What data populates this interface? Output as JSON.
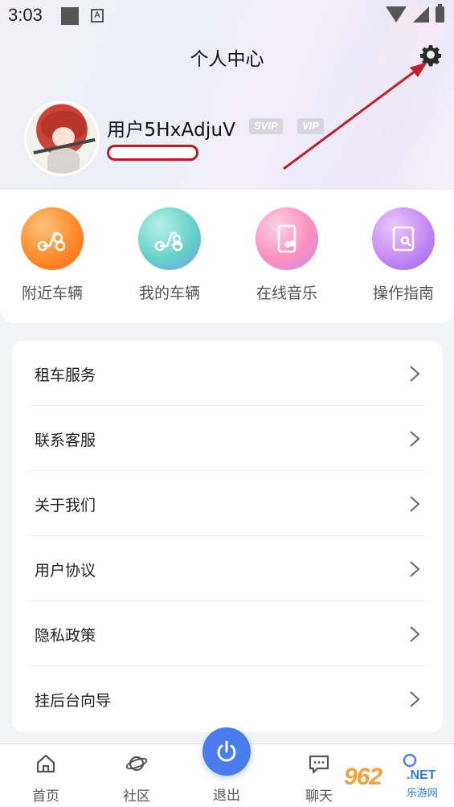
{
  "status_bar": {
    "time": "3:03",
    "notification_icon": "A"
  },
  "header": {
    "title": "个人中心"
  },
  "profile": {
    "username": "用户5HxAdjuV",
    "badges": [
      "SVIP",
      "VIP"
    ]
  },
  "quick_actions": [
    {
      "label": "附近车辆",
      "icon": "nearby-scooter-icon"
    },
    {
      "label": "我的车辆",
      "icon": "my-scooter-icon"
    },
    {
      "label": "在线音乐",
      "icon": "music-phone-icon"
    },
    {
      "label": "操作指南",
      "icon": "guide-icon"
    }
  ],
  "menu": [
    {
      "label": "租车服务"
    },
    {
      "label": "联系客服"
    },
    {
      "label": "关于我们"
    },
    {
      "label": "用户协议"
    },
    {
      "label": "隐私政策"
    },
    {
      "label": "挂后台向导"
    }
  ],
  "tab_bar": {
    "home": "首页",
    "community": "社区",
    "logout": "退出",
    "chat": "聊天"
  },
  "watermark": {
    "brand": "962",
    "suffix": ".NET",
    "sub": "乐游网"
  },
  "colors": {
    "accent": "#4a7cf0",
    "annotation": "#c0202a"
  }
}
